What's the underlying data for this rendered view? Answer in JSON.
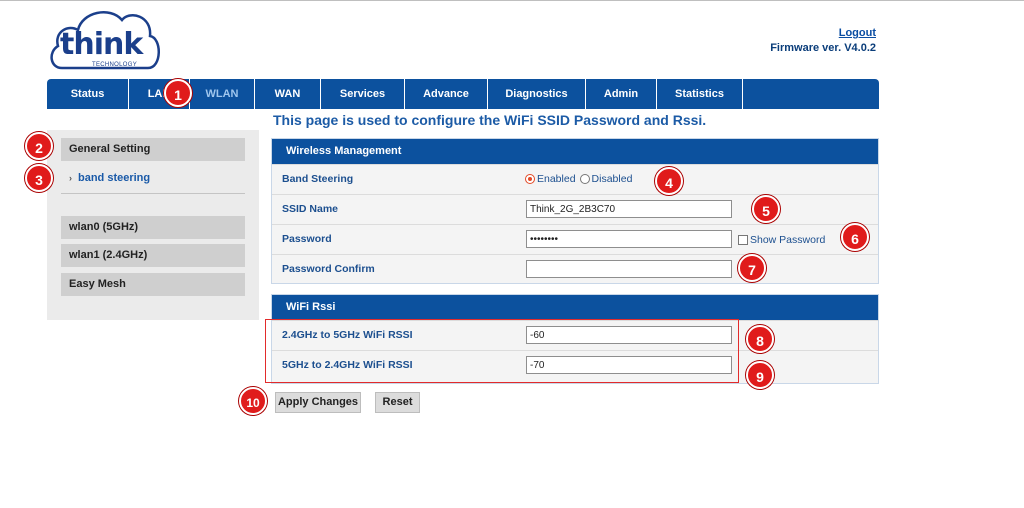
{
  "brand": {
    "logo_text": "think",
    "logo_sub": "TECHNOLOGY"
  },
  "header": {
    "logout": "Logout",
    "firmware": "Firmware ver. V4.0.2"
  },
  "nav": [
    {
      "label": "Status",
      "active": false
    },
    {
      "label": "LAN",
      "active": false
    },
    {
      "label": "WLAN",
      "active": true
    },
    {
      "label": "WAN",
      "active": false
    },
    {
      "label": "Services",
      "active": false
    },
    {
      "label": "Advance",
      "active": false
    },
    {
      "label": "Diagnostics",
      "active": false
    },
    {
      "label": "Admin",
      "active": false
    },
    {
      "label": "Statistics",
      "active": false
    }
  ],
  "sidebar": {
    "general": "General Setting",
    "band_steering": "band steering",
    "wlan0": "wlan0 (5GHz)",
    "wlan1": "wlan1 (2.4GHz)",
    "easy_mesh": "Easy Mesh"
  },
  "page_title": "This page is used to configure the WiFi SSID Password and Rssi.",
  "wireless": {
    "heading": "Wireless Management",
    "band_steering_label": "Band Steering",
    "enabled": "Enabled",
    "disabled": "Disabled",
    "band_steering_value": "Enabled",
    "ssid_label": "SSID Name",
    "ssid_value": "Think_2G_2B3C70",
    "password_label": "Password",
    "password_value": "••••••••",
    "show_password": "Show Password",
    "password_confirm_label": "Password Confirm",
    "password_confirm_value": ""
  },
  "rssi": {
    "heading": "WiFi Rssi",
    "r24_label": "2.4GHz to 5GHz WiFi RSSI",
    "r24_value": "-60",
    "r5_label": "5GHz to 2.4GHz WiFi RSSI",
    "r5_value": "-70"
  },
  "buttons": {
    "apply": "Apply Changes",
    "reset": "Reset"
  },
  "annotations": [
    "1",
    "2",
    "3",
    "4",
    "5",
    "6",
    "7",
    "8",
    "9",
    "10"
  ],
  "colors": {
    "nav_bg": "#0c519e",
    "badge": "#e01b1b",
    "highlight_box": "#e22b2b"
  }
}
